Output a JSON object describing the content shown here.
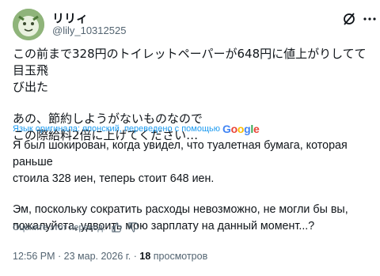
{
  "header": {
    "display_name": "リリィ",
    "handle": "@lily_10312525",
    "avatar_icon": "avatar-image",
    "grok_icon": "grok-icon",
    "more_icon": "more-options-icon"
  },
  "post": {
    "original_lines": [
      "この前まで328円のトイレットペーパーが648円に値上がりしてて目玉飛",
      "び出た",
      "",
      "あの、節約しようがないものなので",
      "この際給料2倍に上げてください…"
    ],
    "translation_note": "Язык оригинала: японский, переведено с помощью",
    "translation_provider": "Google",
    "translated_lines": [
      "Я был шокирован, когда увидел, что туалетная бумага, которая раньше",
      "стоила 328 иен, теперь стоит 648 иен.",
      "",
      "Эм, поскольку сократить расходы невозможно, не могли бы вы,",
      "пожалуйста, удвоить мою зарплату на данный момент...?"
    ],
    "rate_label": "Оцените этот перевод:"
  },
  "meta": {
    "time": "12:56 PM",
    "date": "23 мар. 2026 г.",
    "views_count": "18",
    "views_label": "просмотров"
  },
  "colors": {
    "text": "#0f1419",
    "secondary": "#536471",
    "link": "#1d9bf0"
  }
}
